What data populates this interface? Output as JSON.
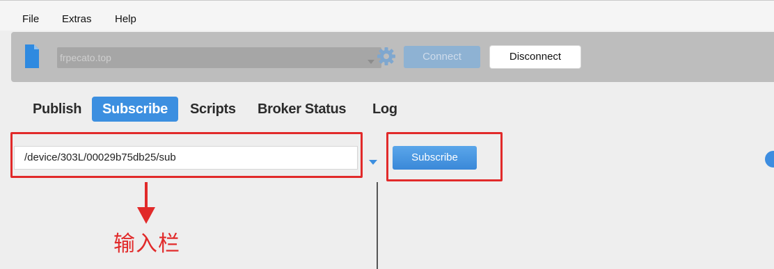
{
  "menu": {
    "file": "File",
    "extras": "Extras",
    "help": "Help"
  },
  "connection": {
    "broker": "frpecato.top",
    "connect_label": "Connect",
    "disconnect_label": "Disconnect"
  },
  "tabs": [
    {
      "label": "Publish",
      "active": false
    },
    {
      "label": "Subscribe",
      "active": true
    },
    {
      "label": "Scripts",
      "active": false
    },
    {
      "label": "Broker Status",
      "active": false
    },
    {
      "label": "Log",
      "active": false
    }
  ],
  "subscribe": {
    "topic_value": "/device/303L/00029b75db25/sub",
    "subscribe_label": "Subscribe"
  },
  "annotation": {
    "text": "输入栏",
    "color": "#e12a2a"
  },
  "colors": {
    "accent": "#3c8fe0",
    "highlight_red": "#e12a2a"
  }
}
